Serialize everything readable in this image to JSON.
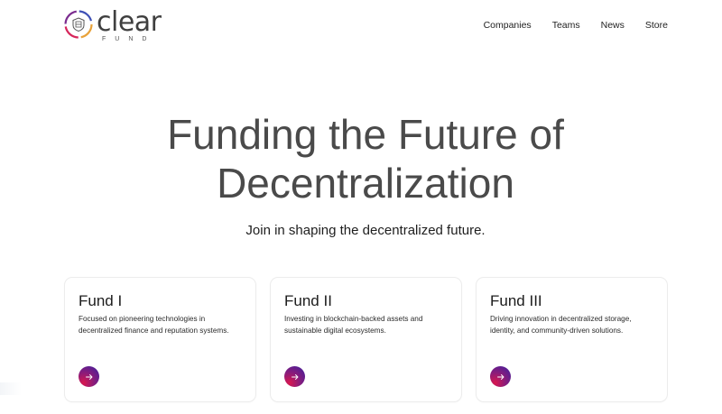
{
  "brand": {
    "word": "clear",
    "sub": "FUND",
    "ring_colors": [
      "#e8a23a",
      "#d6265b",
      "#7b2c8f",
      "#3d4fb5"
    ]
  },
  "nav": {
    "items": [
      {
        "label": "Companies"
      },
      {
        "label": "Teams"
      },
      {
        "label": "News"
      },
      {
        "label": "Store"
      }
    ]
  },
  "hero": {
    "title_line1": "Funding the Future of",
    "title_line2": "Decentralization",
    "subtitle": "Join in shaping the decentralized future."
  },
  "funds": [
    {
      "title": "Fund I",
      "desc_line1": "Focused on pioneering technologies in",
      "desc_line2": "decentralized finance and reputation systems.",
      "action_icon": "arrow-right-icon"
    },
    {
      "title": "Fund II",
      "desc_line1": "Investing in blockchain-backed assets and",
      "desc_line2": "sustainable digital ecosystems.",
      "action_icon": "arrow-right-icon"
    },
    {
      "title": "Fund III",
      "desc_line1": "Driving innovation in decentralized storage,",
      "desc_line2": "identity, and community-driven solutions.",
      "action_icon": "arrow-right-icon"
    }
  ],
  "colors": {
    "button_gradient_start": "#d8174f",
    "button_gradient_end": "#3a1fa0",
    "hero_text": "#4a4a4a"
  }
}
